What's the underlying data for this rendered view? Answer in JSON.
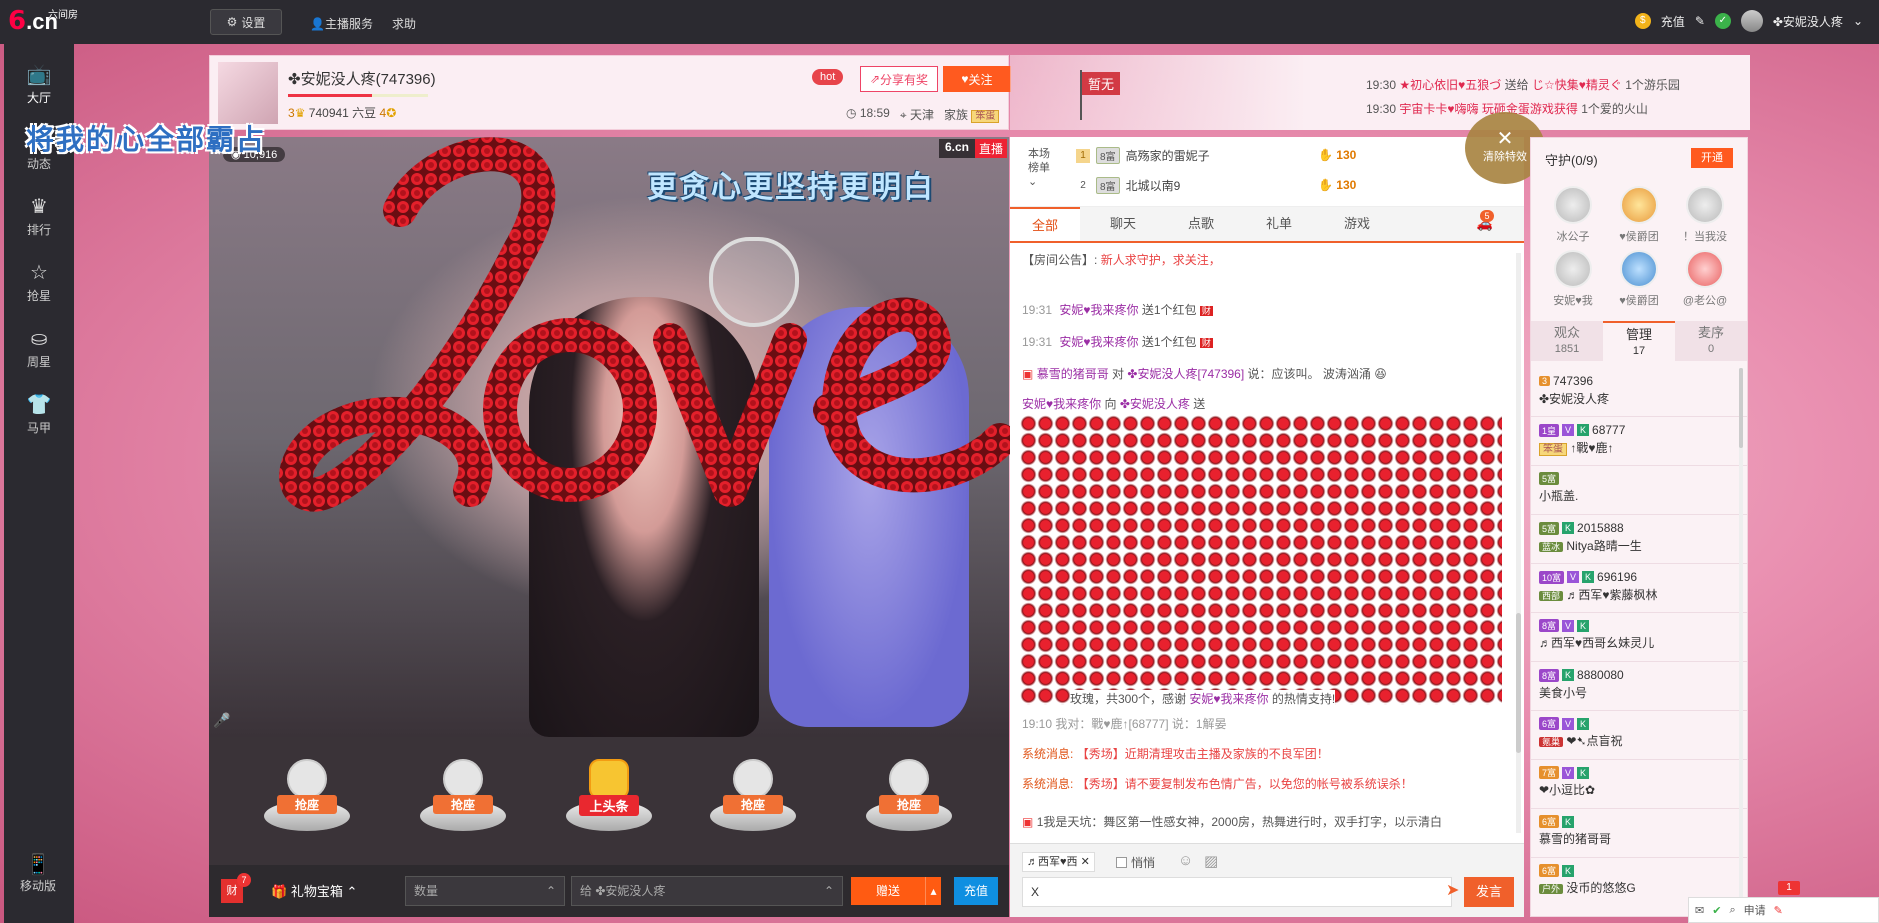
{
  "topbar": {
    "logo_num": "6",
    "logo_cn": ".cn",
    "logo_sub": "六间房",
    "settings": "设置",
    "anchor_service": "主播服务",
    "help": "求助",
    "recharge": "充值",
    "username": "✤安妮没人疼"
  },
  "leftnav": {
    "items": [
      "大厅",
      "动态",
      "排行",
      "抢星",
      "周星",
      "马甲"
    ],
    "icons": [
      "tv-icon",
      "dynamic-icon",
      "crown-icon",
      "star-icon",
      "bag-icon",
      "shirt-icon"
    ],
    "mobile": "移动版"
  },
  "header": {
    "anchor_name": "✤安妮没人疼(747396)",
    "level_left": "3",
    "coins": "740941 六豆",
    "level_right": "4",
    "hot": "hot",
    "share": "分享有奖",
    "follow": "关注",
    "time": "18:59",
    "city": "天津",
    "family_label": "家族",
    "family_badge": "笨蛋"
  },
  "ticker": {
    "flag": "暂无",
    "lines": [
      {
        "time": "19:30",
        "from": "★初心依旧♥五狼づ",
        "verb": "送给",
        "to": "じ☆快集♥精灵ぐ",
        "gift": "1个游乐园"
      },
      {
        "time": "19:30",
        "from": "宇宙卡卡♥嗨嗨",
        "verb": "玩砸金蛋游戏获得",
        "to": "",
        "gift": "1个爱的火山"
      }
    ]
  },
  "song_title": "将我的心全部霸占",
  "video": {
    "viewers": "10,916",
    "brand": "6.cn",
    "live": "直播",
    "lyric": "更贪心更坚持更明白"
  },
  "seats": {
    "labels": [
      "抢座",
      "抢座",
      "上头条",
      "抢座",
      "抢座"
    ]
  },
  "bottombar": {
    "badge": "7",
    "gift_box": "礼物宝箱",
    "quantity_placeholder": "数量",
    "to_label": "给 ✤安妮没人疼",
    "send": "赠送",
    "recharge": "充值"
  },
  "ranking": {
    "title": "本场榜单",
    "rows": [
      {
        "no": "1",
        "level": "8富",
        "name": "高殇家的雷妮子",
        "value": "130"
      },
      {
        "no": "2",
        "level": "8富",
        "name": "北城以南9",
        "value": "130"
      }
    ]
  },
  "clear_effects": "清除特效",
  "chat_tabs": {
    "items": [
      "全部",
      "聊天",
      "点歌",
      "礼单",
      "游戏"
    ],
    "badge": "5"
  },
  "chat": {
    "notice_label": "【房间公告】:",
    "notice_text": "新人求守护，求关注，",
    "m1_time": "19:31",
    "m1_user": "安妮♥我来疼你",
    "m1_text": "送1个红包",
    "m2_time": "19:31",
    "m2_user": "安妮♥我来疼你",
    "m2_text": "送1个红包",
    "m3_user": "慕雪的猪哥哥",
    "m3_text": "对",
    "m3_target": "✤安妮没人疼[747396]",
    "m3_say": "说：应该叫。 波涛汹涌",
    "m4_user": "安妮♥我来疼你",
    "m4_text": "向",
    "m4_target": "✤安妮没人疼",
    "m4_send": "送",
    "rose_text": "玫瑰，共300个，感谢",
    "rose_user": "安妮♥我来疼你",
    "rose_thanks": "的热情支持!",
    "m5": "19:10  我对：戰♥鹿↑[68777] 说：1解晏",
    "sys_label": "系统消息:",
    "sys1": "【秀场】近期清理攻击主播及家族的不良军团！",
    "sys2": "【秀场】请不要复制发布色情广告，以免您的帐号被系统误杀！",
    "promo": "1我是天坑：舞区第一性感女神，2000房，热舞进行时，双手打字，以示清白"
  },
  "input": {
    "target": "♬西军♥西",
    "private": "悄悄",
    "value": "X",
    "send": "发言"
  },
  "right_panel": {
    "guard_title": "守护(0/9)",
    "open": "开通",
    "guards": [
      "冰公子",
      "♥侯爵团",
      "！当我没",
      "安妮♥我",
      "♥侯爵团",
      "@老公@"
    ],
    "tabs": [
      {
        "label": "观众",
        "count": "1851"
      },
      {
        "label": "管理",
        "count": "17"
      },
      {
        "label": "麦序",
        "count": "0"
      }
    ],
    "users": [
      {
        "badge": "3",
        "id": "747396",
        "name": "✤安妮没人疼"
      },
      {
        "badge": "1皇",
        "id": "68777",
        "name": "↑戰♥鹿↑",
        "family": "笨蛋"
      },
      {
        "badge": "5富",
        "id": "",
        "name": "小瓶盖."
      },
      {
        "badge": "5富",
        "id": "2015888",
        "name": "Nitya路晴一生",
        "family": "蓝冰"
      },
      {
        "badge": "10富",
        "id": "696196",
        "name": "♬西军♥紫藤枫林",
        "family": "西部"
      },
      {
        "badge": "8富",
        "id": "",
        "name": "♬西军♥西哥幺妹灵儿"
      },
      {
        "badge": "8富",
        "id": "8880080",
        "name": "美食小号"
      },
      {
        "badge": "6富",
        "id": "",
        "name": "❤➷点盲祝",
        "family": "氪巢"
      },
      {
        "badge": "7富",
        "id": "",
        "name": "❤小逗比✿"
      },
      {
        "badge": "6富",
        "id": "",
        "name": "慕雪的猪哥哥"
      },
      {
        "badge": "6富",
        "id": "",
        "name": "没币的悠悠G",
        "family": "户外"
      }
    ]
  },
  "dock": {
    "badge": "1",
    "apply": "申请"
  },
  "colors": {
    "accent": "#f0602b",
    "topbar": "#2b2a30",
    "page_bg": "#e98fb0"
  }
}
